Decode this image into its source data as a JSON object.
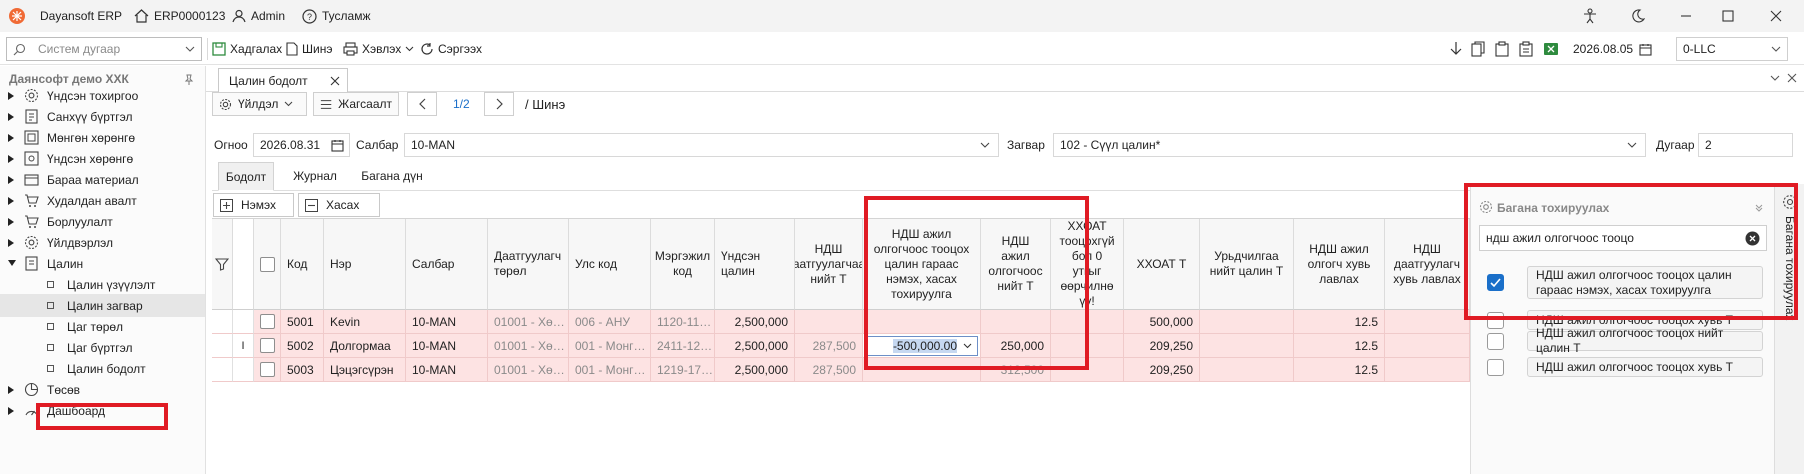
{
  "app": {
    "name": "Dayansoft ERP",
    "doc_code": "ERP0000123",
    "user": "Admin",
    "help": "Тусламж"
  },
  "toolbar": {
    "search_placeholder": "Систем дугаар",
    "save": "Хадгалах",
    "new": "Шинэ",
    "print": "Хэвлэх",
    "refresh": "Сэргээх",
    "date": "2026.08.05",
    "company": "0-LLC"
  },
  "sidebar": {
    "title": "Даянсофт демо ХХК",
    "items": [
      {
        "label": "Үндсэн тохиргоо",
        "icon": "gear-icon"
      },
      {
        "label": "Санхүү бүртгэл",
        "icon": "ledger-icon"
      },
      {
        "label": "Мөнгөн хөрөнгө",
        "icon": "money-icon"
      },
      {
        "label": "Үндсэн хөрөнгө",
        "icon": "asset-icon"
      },
      {
        "label": "Бараа материал",
        "icon": "box-icon"
      },
      {
        "label": "Худалдан авалт",
        "icon": "cart-icon"
      },
      {
        "label": "Борлуулалт",
        "icon": "sales-cart-icon"
      },
      {
        "label": "Үйлдвэрлэл",
        "icon": "factory-icon"
      },
      {
        "label": "Цалин",
        "icon": "salary-icon"
      }
    ],
    "sub_items": [
      {
        "label": "Цалин үзүүлэлт"
      },
      {
        "label": "Цалин загвар"
      },
      {
        "label": "Цаг төрөл"
      },
      {
        "label": "Цаг бүртгэл"
      },
      {
        "label": "Цалин бодолт"
      }
    ],
    "after_items": [
      {
        "label": "Төсөв",
        "icon": "budget-icon"
      },
      {
        "label": "Дашбоард",
        "icon": "dashboard-icon"
      }
    ]
  },
  "doc_tab": {
    "label": "Цалин бодолт"
  },
  "actions": {
    "action_menu": "Үйлдэл",
    "list": "Жагсаалт",
    "pager": "1/2",
    "status": "/ Шинэ"
  },
  "form": {
    "date_label": "Огноо",
    "date_value": "2026.08.31",
    "branch_label": "Салбар",
    "branch_value": "10-MAN",
    "template_label": "Загвар",
    "template_value": "102 - Сүүл цалин*",
    "number_label": "Дугаар",
    "number_value": "2"
  },
  "form_tabs": [
    "Бодолт",
    "Журнал",
    "Багана дүн"
  ],
  "grid_actions": {
    "add": "Нэмэх",
    "remove": "Хасах"
  },
  "grid": {
    "columns": [
      "Код",
      "Нэр",
      "Салбар",
      "Даатгуулагч төрөл",
      "Улс код",
      "Мэргэжил код",
      "Үндсэн цалин",
      "НДШ даатгуулагчаас нийт Т",
      "НДШ ажил олгогчоос тооцох цалин гараас нэмэх, хасах тохируулга",
      "НДШ ажил олгогчоос нийт Т",
      "ХХОАТ тооцохгүй бол 0 утгыг өөрчилнө үү!",
      "ХХОАТ Т",
      "Урьдчилгаа нийт цалин Т",
      "НДШ ажил олгогч хувь лавлах",
      "НДШ даатгуулагч хувь лавлах"
    ],
    "rows": [
      {
        "code": "5001",
        "name": "Kevin",
        "branch": "10-MAN",
        "insured_type": "01001 - Хө…",
        "country": "006 - АНУ",
        "profession": "1120-11…",
        "base_salary": "2,500,000",
        "ndsh_insured": "",
        "ndsh_adjust": "",
        "ndsh_employer": "",
        "pit_flag": "",
        "pit": "500,000",
        "advance": "",
        "employer_rate": "12.5",
        "insured_rate": ""
      },
      {
        "code": "5002",
        "name": "Долгормаа",
        "branch": "10-MAN",
        "insured_type": "01001 - Хө…",
        "country": "001 - Монг…",
        "profession": "2411-12…",
        "base_salary": "2,500,000",
        "ndsh_insured": "287,500",
        "ndsh_adjust": "-500,000.00",
        "ndsh_employer": "250,000",
        "pit_flag": "",
        "pit": "209,250",
        "advance": "",
        "employer_rate": "12.5",
        "insured_rate": ""
      },
      {
        "code": "5003",
        "name": "Цэцэгсүрэн",
        "branch": "10-MAN",
        "insured_type": "01001 - Хө…",
        "country": "001 - Монг…",
        "profession": "1219-17…",
        "base_salary": "2,500,000",
        "ndsh_insured": "287,500",
        "ndsh_adjust": "",
        "ndsh_employer": "312,500",
        "pit_flag": "",
        "pit": "209,250",
        "advance": "",
        "employer_rate": "12.5",
        "insured_rate": ""
      }
    ]
  },
  "column_panel": {
    "title": "Багана тохируулах",
    "side_label": "Багана тохируулах",
    "search_value": "ндш ажил олгогчоос тооцо",
    "options": [
      {
        "label": "НДШ ажил олгогчоос тооцох цалин гараас нэмэх, хасах тохируулга",
        "checked": true
      },
      {
        "label": "НДШ ажил олгогчоос тооцох хувь Т",
        "checked": false
      },
      {
        "label": "НДШ ажил олгогчоос тооцох нийт цалин Т",
        "checked": false
      },
      {
        "label": "НДШ ажил олгогчоос тооцох хувь Т",
        "checked": false
      }
    ]
  },
  "colors": {
    "accent": "#e01b24",
    "row_bg": "#fde3e3",
    "link": "#1a6fc9"
  }
}
